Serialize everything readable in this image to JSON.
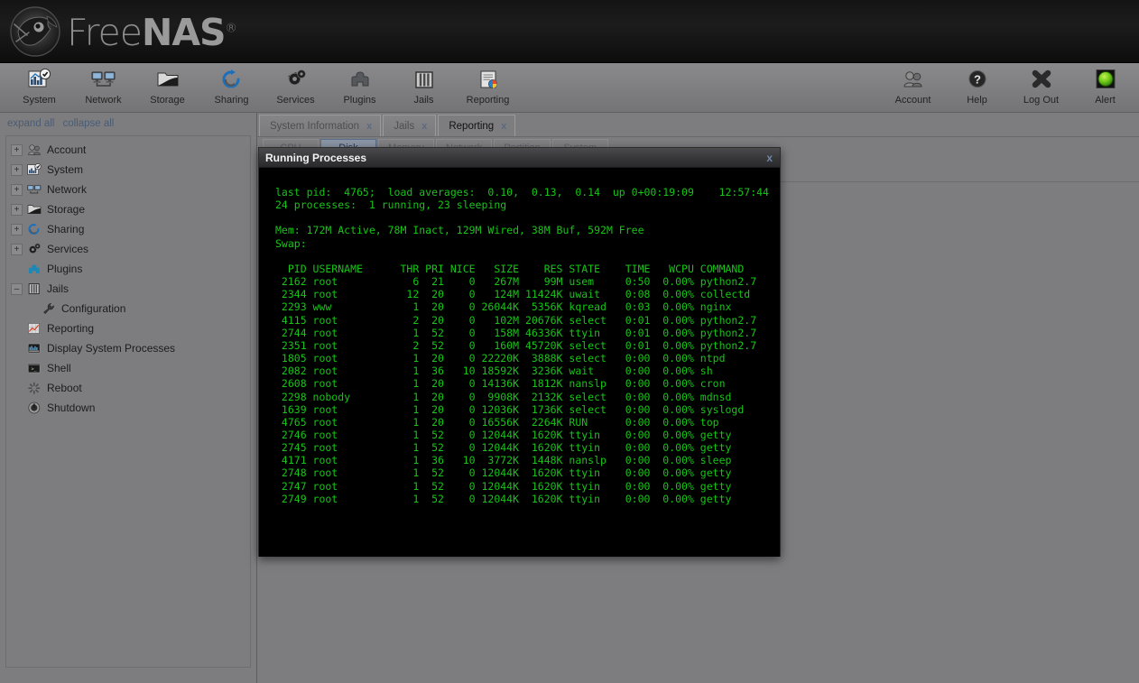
{
  "header": {
    "logo_text_light": "Free",
    "logo_text_bold": "NAS",
    "logo_reg": "®",
    "logo_icon": "freenas-fish-logo"
  },
  "toolbar": {
    "left_items": [
      {
        "label": "System",
        "icon": "system-chart-check-icon"
      },
      {
        "label": "Network",
        "icon": "network-two-monitors-icon"
      },
      {
        "label": "Storage",
        "icon": "storage-folder-icon"
      },
      {
        "label": "Sharing",
        "icon": "sharing-refresh-icon"
      },
      {
        "label": "Services",
        "icon": "services-gears-icon"
      },
      {
        "label": "Plugins",
        "icon": "plugins-puzzle-icon"
      },
      {
        "label": "Jails",
        "icon": "jails-bars-icon"
      },
      {
        "label": "Reporting",
        "icon": "reporting-chart-page-icon"
      }
    ],
    "right_items": [
      {
        "label": "Account",
        "icon": "account-users-icon"
      },
      {
        "label": "Help",
        "icon": "help-question-icon"
      },
      {
        "label": "Log Out",
        "icon": "logout-x-icon"
      },
      {
        "label": "Alert",
        "icon": "alert-green-led-icon"
      }
    ]
  },
  "sidebar": {
    "expand_all": "expand all",
    "collapse_all": "collapse all",
    "tree": [
      {
        "label": "Account",
        "icon": "account-users-icon",
        "expander": "+",
        "indent": "root"
      },
      {
        "label": "System",
        "icon": "system-chart-check-icon",
        "expander": "+",
        "indent": "root"
      },
      {
        "label": "Network",
        "icon": "network-two-monitors-icon",
        "expander": "+",
        "indent": "root"
      },
      {
        "label": "Storage",
        "icon": "storage-folder-icon",
        "expander": "+",
        "indent": "root"
      },
      {
        "label": "Sharing",
        "icon": "sharing-refresh-icon",
        "expander": "+",
        "indent": "root"
      },
      {
        "label": "Services",
        "icon": "services-gears-icon",
        "expander": "+",
        "indent": "root"
      },
      {
        "label": "Plugins",
        "icon": "plugins-puzzle-icon",
        "expander": "",
        "indent": "noexp"
      },
      {
        "label": "Jails",
        "icon": "jails-bars-icon",
        "expander": "–",
        "indent": "root"
      },
      {
        "label": "Configuration",
        "icon": "wrench-icon",
        "expander": "",
        "indent": "child"
      },
      {
        "label": "Reporting",
        "icon": "reporting-graph-icon",
        "expander": "",
        "indent": "noexp"
      },
      {
        "label": "Display System Processes",
        "icon": "display-processes-icon",
        "expander": "",
        "indent": "noexp"
      },
      {
        "label": "Shell",
        "icon": "shell-terminal-icon",
        "expander": "",
        "indent": "noexp"
      },
      {
        "label": "Reboot",
        "icon": "reboot-spinner-icon",
        "expander": "",
        "indent": "noexp"
      },
      {
        "label": "Shutdown",
        "icon": "shutdown-power-icon",
        "expander": "",
        "indent": "noexp"
      }
    ]
  },
  "tabs": [
    {
      "label": "System Information",
      "close": "x",
      "active": false
    },
    {
      "label": "Jails",
      "close": "x",
      "active": false
    },
    {
      "label": "Reporting",
      "close": "x",
      "active": true
    }
  ],
  "subtabs": [
    {
      "label": "CPU",
      "active": false
    },
    {
      "label": "Disk",
      "active": true
    },
    {
      "label": "Memory",
      "active": false
    },
    {
      "label": "Network",
      "active": false
    },
    {
      "label": "Partition",
      "active": false
    },
    {
      "label": "System",
      "active": false
    }
  ],
  "dialog": {
    "title": "Running Processes",
    "close_label": "x",
    "terminal": {
      "text_color": "#17c417",
      "background": "#000000",
      "lines": [
        "last pid:  4765;  load averages:  0.10,  0.13,  0.14  up 0+00:19:09    12:57:44",
        "24 processes:  1 running, 23 sleeping",
        "",
        "Mem: 172M Active, 78M Inact, 129M Wired, 38M Buf, 592M Free",
        "Swap: ",
        "",
        "  PID USERNAME      THR PRI NICE   SIZE    RES STATE    TIME   WCPU COMMAND",
        " 2162 root            6  21    0   267M    99M usem     0:50  0.00% python2.7",
        " 2344 root           12  20    0   124M 11424K uwait    0:08  0.00% collectd",
        " 2293 www             1  20    0 26044K  5356K kqread   0:03  0.00% nginx",
        " 4115 root            2  20    0   102M 20676K select   0:01  0.00% python2.7",
        " 2744 root            1  52    0   158M 46336K ttyin    0:01  0.00% python2.7",
        " 2351 root            2  52    0   160M 45720K select   0:01  0.00% python2.7",
        " 1805 root            1  20    0 22220K  3888K select   0:00  0.00% ntpd",
        " 2082 root            1  36   10 18592K  3236K wait     0:00  0.00% sh",
        " 2608 root            1  20    0 14136K  1812K nanslp   0:00  0.00% cron",
        " 2298 nobody          1  20    0  9908K  2132K select   0:00  0.00% mdnsd",
        " 1639 root            1  20    0 12036K  1736K select   0:00  0.00% syslogd",
        " 4765 root            1  20    0 16556K  2264K RUN      0:00  0.00% top",
        " 2746 root            1  52    0 12044K  1620K ttyin    0:00  0.00% getty",
        " 2745 root            1  52    0 12044K  1620K ttyin    0:00  0.00% getty",
        " 4171 root            1  36   10  3772K  1448K nanslp   0:00  0.00% sleep",
        " 2748 root            1  52    0 12044K  1620K ttyin    0:00  0.00% getty",
        " 2747 root            1  52    0 12044K  1620K ttyin    0:00  0.00% getty",
        " 2749 root            1  52    0 12044K  1620K ttyin    0:00  0.00% getty"
      ]
    }
  },
  "colors": {
    "chrome_gray": "#7d7d80",
    "header_black": "#141414",
    "terminal_green": "#17c417",
    "link_blue": "#4a5c73",
    "alert_green": "#5fc21a"
  }
}
